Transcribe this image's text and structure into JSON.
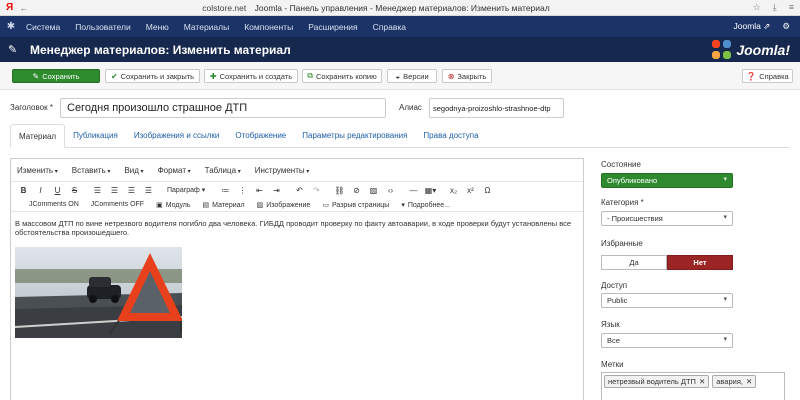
{
  "browser": {
    "ya": "Я",
    "back": "←",
    "host": "colstore.net",
    "page_title": "Joomla - Панель управления - Менеджер материалов: Изменить материал",
    "tool_icons": [
      "bookmark-star-icon",
      "download-icon",
      "menu-icon"
    ]
  },
  "admin_menu": {
    "items": [
      "Система",
      "Пользователи",
      "Меню",
      "Материалы",
      "Компоненты",
      "Расширения",
      "Справка"
    ],
    "right_label": "Joomla ⇗",
    "gear": "⚙"
  },
  "title_bar": {
    "title": "Менеджер материалов: Изменить материал",
    "brand": "Joomla!"
  },
  "toolbar": {
    "save": "Сохранить",
    "save_close": "Сохранить и закрыть",
    "save_new": "Сохранить и создать",
    "save_copy": "Сохранить копию",
    "versions": "Версии",
    "close": "Закрыть",
    "help": "Справка"
  },
  "form": {
    "title_label": "Заголовок *",
    "title_value": "Сегодня произошло страшное ДТП",
    "alias_label": "Алиас",
    "alias_value": "segodnya-proizoshlo-strashnoe-dtp"
  },
  "tabs": [
    "Материал",
    "Публикация",
    "Изображения и ссылки",
    "Отображение",
    "Параметры редактирования",
    "Права доступа"
  ],
  "editor": {
    "menus": [
      "Изменить",
      "Вставить",
      "Вид",
      "Формат",
      "Таблица",
      "Инструменты"
    ],
    "paragraph_select": "Параграф",
    "plugins": [
      {
        "icon": "",
        "label": "JComments ON"
      },
      {
        "icon": "",
        "label": "JComments OFF"
      },
      {
        "icon": "▣",
        "label": "Модуль"
      },
      {
        "icon": "▤",
        "label": "Материал"
      },
      {
        "icon": "▨",
        "label": "Изображение"
      },
      {
        "icon": "▭",
        "label": "Разрыв страницы"
      },
      {
        "icon": "▾",
        "label": "Подробнее..."
      }
    ],
    "body_text": "В массовом ДТП по вине нетрезвого водителя погибло два человека. ГИБДД проводит проверку по факту автоаварии, в ходе проверки будут установлены все обстоятельства произошедшего."
  },
  "sidebar": {
    "status_label": "Состояние",
    "status_value": "Опубликовано",
    "category_label": "Категория *",
    "category_value": "- Происшествия",
    "featured_label": "Избранные",
    "featured_yes": "Да",
    "featured_no": "Нет",
    "access_label": "Доступ",
    "access_value": "Public",
    "language_label": "Язык",
    "language_value": "Все",
    "tags_label": "Метки",
    "tags": [
      "нетрезвый водитель ДТП",
      "авария,"
    ]
  },
  "colors": {
    "admin_nav": "#1b3366",
    "title_bar": "#17284f",
    "primary_green": "#2d8a2d",
    "no_red": "#9b2424",
    "link_blue": "#1f5eaa"
  }
}
